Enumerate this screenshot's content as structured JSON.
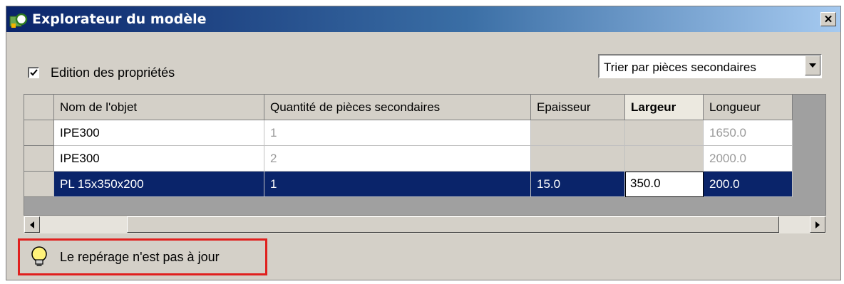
{
  "window": {
    "title": "Explorateur du modèle",
    "close_label": "✕"
  },
  "options": {
    "edit_properties_label": "Edition des propriétés",
    "edit_properties_checked": true,
    "sort_selected": "Trier par pièces secondaires"
  },
  "table": {
    "columns": [
      "Nom de l'objet",
      "Quantité de pièces secondaires",
      "Epaisseur",
      "Largeur",
      "Longueur"
    ],
    "rows": [
      [
        "IPE300",
        "1",
        "",
        "",
        "1650.0"
      ],
      [
        "IPE300",
        "2",
        "",
        "",
        "2000.0"
      ],
      [
        "PL 15x350x200",
        "1",
        "15.0",
        "350.0",
        "200.0"
      ]
    ],
    "selected_row": 2,
    "active_column": "Largeur"
  },
  "status": {
    "message": "Le repérage n'est pas à jour"
  }
}
